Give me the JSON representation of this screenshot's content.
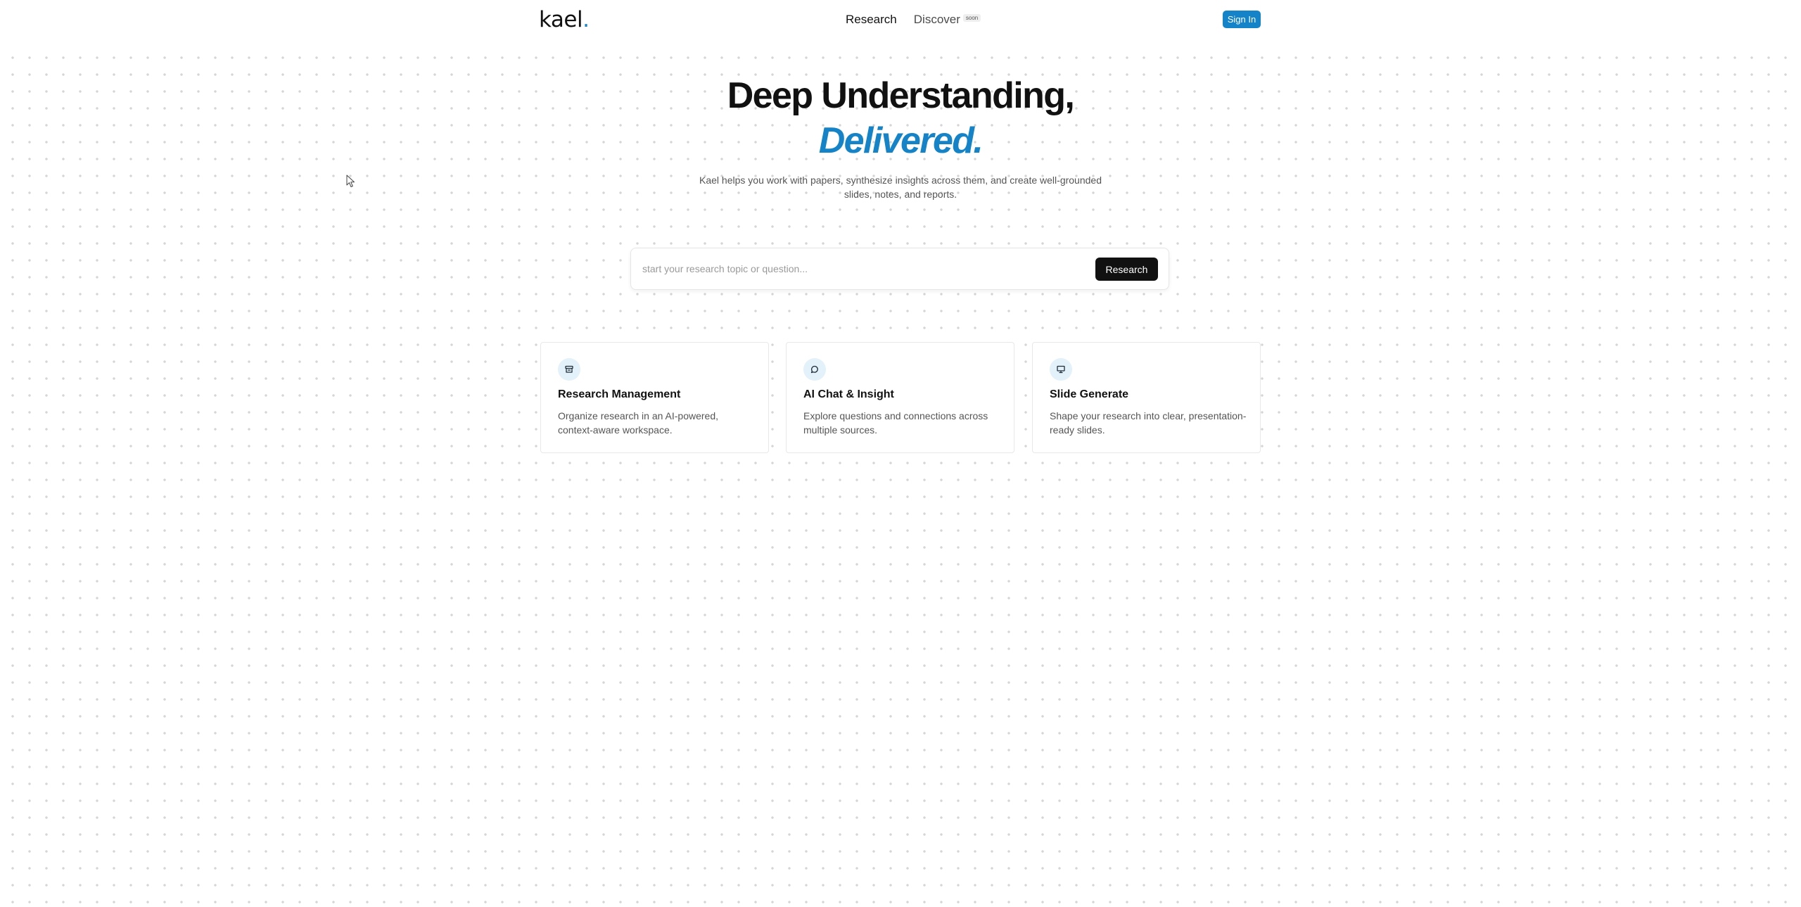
{
  "header": {
    "logo_text": "kael",
    "logo_dot": ".",
    "nav": {
      "research_label": "Research",
      "discover_label": "Discover",
      "discover_badge": "soon"
    },
    "signin_label": "Sign In"
  },
  "hero": {
    "title": "Deep Understanding,",
    "accent": "Delivered.",
    "subtitle": "Kael helps you work with papers, synthesize insights across them, and create well-grounded slides, notes, and reports."
  },
  "search": {
    "placeholder": "start your research topic or question...",
    "value": "",
    "button_label": "Research"
  },
  "features": [
    {
      "icon": "archive-icon",
      "title": "Research Management",
      "description": "Organize research in an AI-powered, context-aware workspace."
    },
    {
      "icon": "chat-icon",
      "title": "AI Chat & Insight",
      "description": "Explore questions and connections across multiple sources."
    },
    {
      "icon": "presentation-icon",
      "title": "Slide Generate",
      "description": "Shape your research into clear, presentation-ready slides."
    }
  ],
  "colors": {
    "accent": "#1483c7",
    "text": "#111111",
    "muted": "#555555",
    "icon_bg": "#e3f1fb"
  }
}
